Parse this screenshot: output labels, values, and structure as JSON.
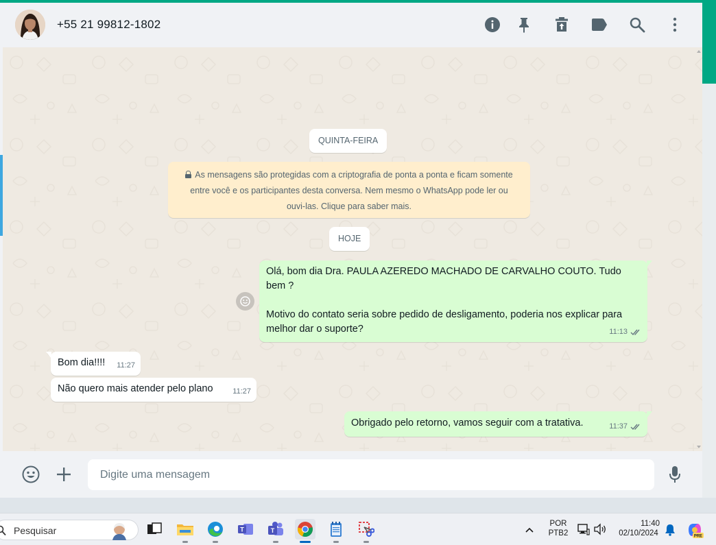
{
  "header": {
    "contact_name": "+55 21 99812-1802",
    "icons": [
      "info-icon",
      "pin-icon",
      "archive-icon",
      "label-icon",
      "search-icon",
      "more-icon"
    ]
  },
  "chat": {
    "date_dividers": [
      "QUINTA-FEIRA",
      "HOJE"
    ],
    "encryption_notice": "As mensagens são protegidas com a criptografia de ponta a ponta e ficam somente entre você e os participantes desta conversa. Nem mesmo o WhatsApp pode ler ou ouvi-las. Clique para saber mais.",
    "messages": [
      {
        "direction": "out",
        "text": "Olá, bom dia Dra. PAULA AZEREDO MACHADO DE CARVALHO COUTO. Tudo bem ?\n\nMotivo do contato seria sobre pedido de desligamento, poderia nos explicar para melhor dar o suporte?",
        "time": "11:13",
        "status": "read"
      },
      {
        "direction": "in",
        "text": "Bom dia!!!!",
        "time": "11:27"
      },
      {
        "direction": "in",
        "text": "Não quero mais atender pelo plano",
        "time": "11:27"
      },
      {
        "direction": "out",
        "text": "Obrigado pelo retorno, vamos seguir com a tratativa.",
        "time": "11:37",
        "status": "read"
      }
    ]
  },
  "composer": {
    "placeholder": "Digite uma mensagem",
    "value": ""
  },
  "taskbar": {
    "search_placeholder": "Pesquisar",
    "language_top": "POR",
    "language_bottom": "PTB2",
    "time": "11:40",
    "date": "02/10/2024",
    "apps": [
      "task-view",
      "file-explorer",
      "edge",
      "teams-classic",
      "teams",
      "chrome",
      "notepad",
      "snipping-tool"
    ],
    "colors": {
      "accent": "#0067c0"
    }
  },
  "colors": {
    "whatsapp_green": "#00a884",
    "outgoing_bubble": "#d9fdd3",
    "incoming_bubble": "#ffffff",
    "encryption_notice": "#ffeecd",
    "chat_background": "#efeae2",
    "read_ticks": "#667781"
  }
}
